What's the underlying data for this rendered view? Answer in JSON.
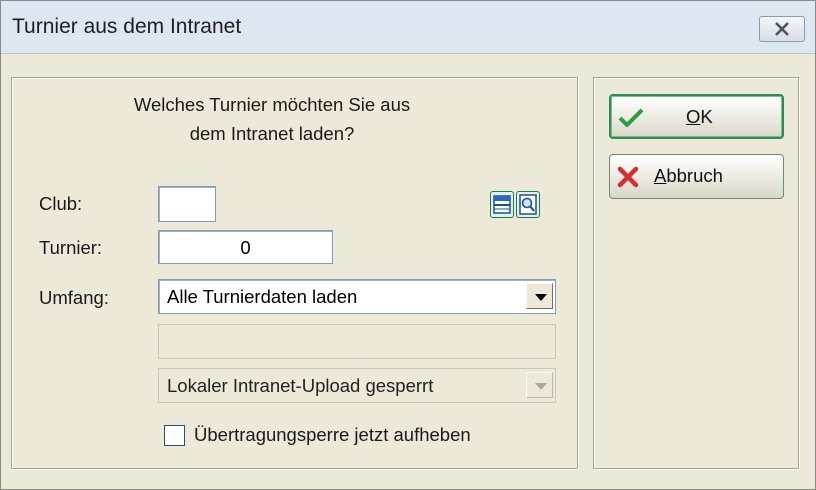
{
  "window": {
    "title": "Turnier aus dem Intranet"
  },
  "dialog": {
    "question_line1": "Welches Turnier möchten Sie aus",
    "question_line2": "dem Intranet laden?",
    "club_label": "Club:",
    "club_value": "",
    "turnier_label": "Turnier:",
    "turnier_value": "0",
    "umfang_label": "Umfang:",
    "umfang_selected": "Alle Turnierdaten laden",
    "info_value": "",
    "upload_selected": "Lokaler Intranet-Upload gesperrt",
    "checkbox_label": "Übertragungsperre jetzt aufheben",
    "checkbox_checked": false
  },
  "buttons": {
    "ok_label": "OK",
    "cancel_label": "Abbruch"
  },
  "icons": {
    "close": "close-icon",
    "list": "list-icon",
    "search": "search-icon",
    "ok": "checkmark-icon",
    "cancel": "x-icon"
  },
  "colors": {
    "accent_green": "#2E8B57",
    "cancel_red": "#D32F2F",
    "check_green": "#2E9E3C"
  }
}
